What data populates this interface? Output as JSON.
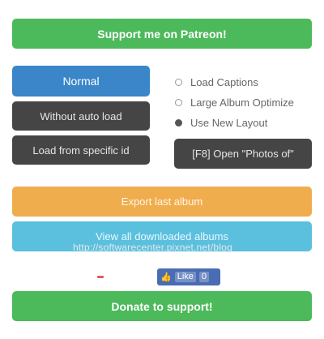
{
  "buttons": {
    "patreon": "Support me on Patreon!",
    "normal": "Normal",
    "without_auto_load": "Without auto load",
    "load_from_specific": "Load from specific id",
    "open_photos": "[F8] Open \"Photos of\"",
    "export_album": "Export last album",
    "view_downloaded": "View all downloaded albums",
    "donate": "Donate to support!"
  },
  "options": [
    {
      "label": "Load Captions",
      "checked": false
    },
    {
      "label": "Large Album Optimize",
      "checked": false
    },
    {
      "label": "Use New Layout",
      "checked": true
    }
  ],
  "watermark": "http://softwarecenter.pixnet.net/blog",
  "social": {
    "like_label": "Like",
    "count": "0"
  },
  "colors": {
    "green": "#4cba5a",
    "blue": "#3a86c8",
    "dark": "#454545",
    "orange": "#f0ad4e",
    "cyan": "#5bc0de"
  }
}
